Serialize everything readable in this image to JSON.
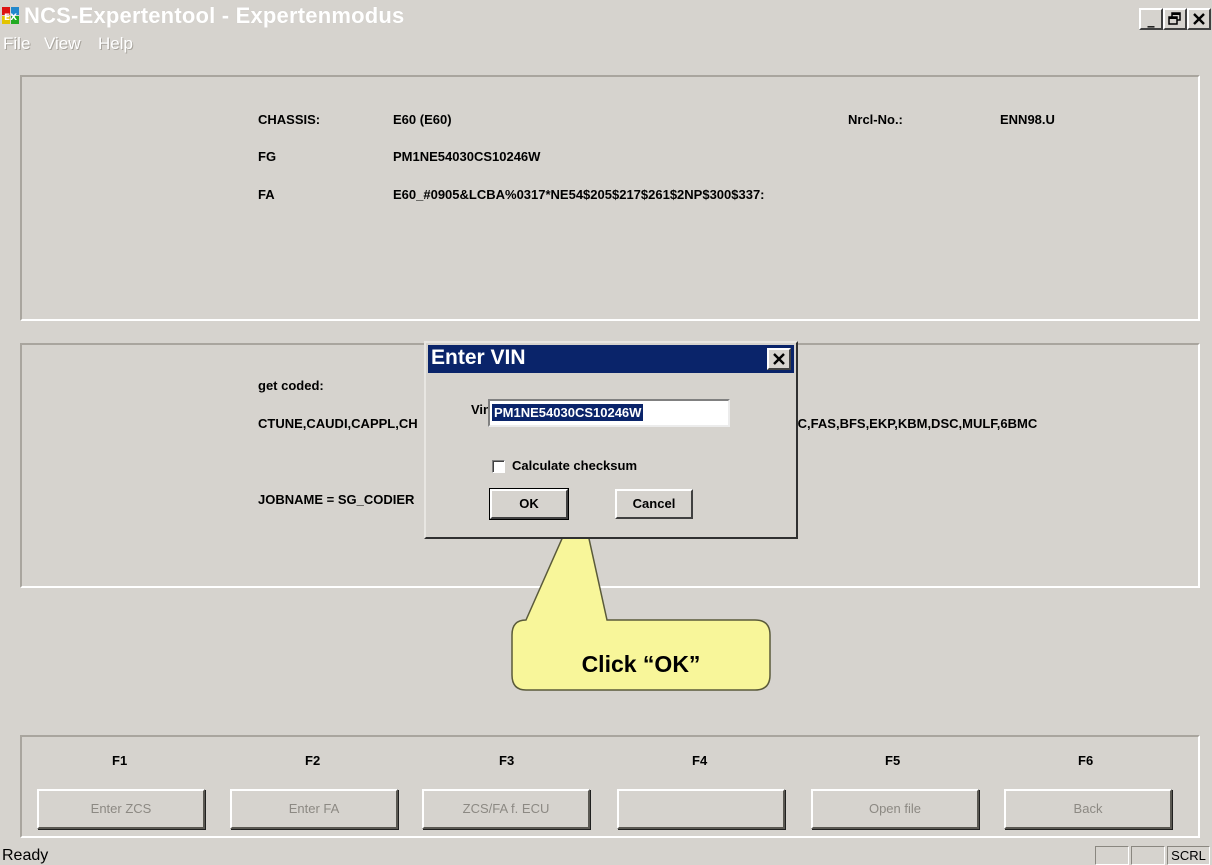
{
  "window": {
    "title": "NCS-Expertentool - Expertenmodus",
    "min_glyph": "_",
    "max_glyph": "🗗",
    "close_glyph": "✕"
  },
  "menu": [
    "File",
    "View",
    "Help"
  ],
  "info": {
    "chassis_label": "CHASSIS:",
    "chassis_value": "E60 (E60)",
    "nrcl_label": "Nrcl-No.:",
    "nrcl_value": "ENN98.U",
    "fg_label": "FG",
    "fg_value": "PM1NE54030CS10246W",
    "fa_label": "FA",
    "fa_value": "E60_#0905&LCBA%0317*NE54$205$217$261$2NP$300$337:"
  },
  "job": {
    "get_coded_label": "get coded:",
    "modules_left": "CTUNE,CAUDI,CAPPL,CH",
    "modules_right": ",PDC,FAS,BFS,EKP,KBM,DSC,MULF,6BMC",
    "jobname": "JOBNAME = SG_CODIER"
  },
  "function_keys": [
    "F1",
    "F2",
    "F3",
    "F4",
    "F5",
    "F6"
  ],
  "function_buttons": [
    "Enter ZCS",
    "Enter FA",
    "ZCS/FA f. ECU",
    "",
    "Open file",
    "Back"
  ],
  "status": {
    "text": "Ready",
    "panels": [
      "",
      "",
      "SCRL"
    ]
  },
  "dialog": {
    "title": "Enter VIN",
    "close_glyph": "✕",
    "vin_label": "Vin:",
    "vin_value": "PM1NE54030CS10246W",
    "checksum_label": "Calculate checksum",
    "checksum_checked": false,
    "ok_label": "OK",
    "cancel_label": "Cancel"
  },
  "callout": {
    "text": "Click “OK”",
    "fill": "#f8f69a"
  },
  "colors": {
    "face": "#d6d3ce",
    "dialog_title": "#0a246a"
  }
}
